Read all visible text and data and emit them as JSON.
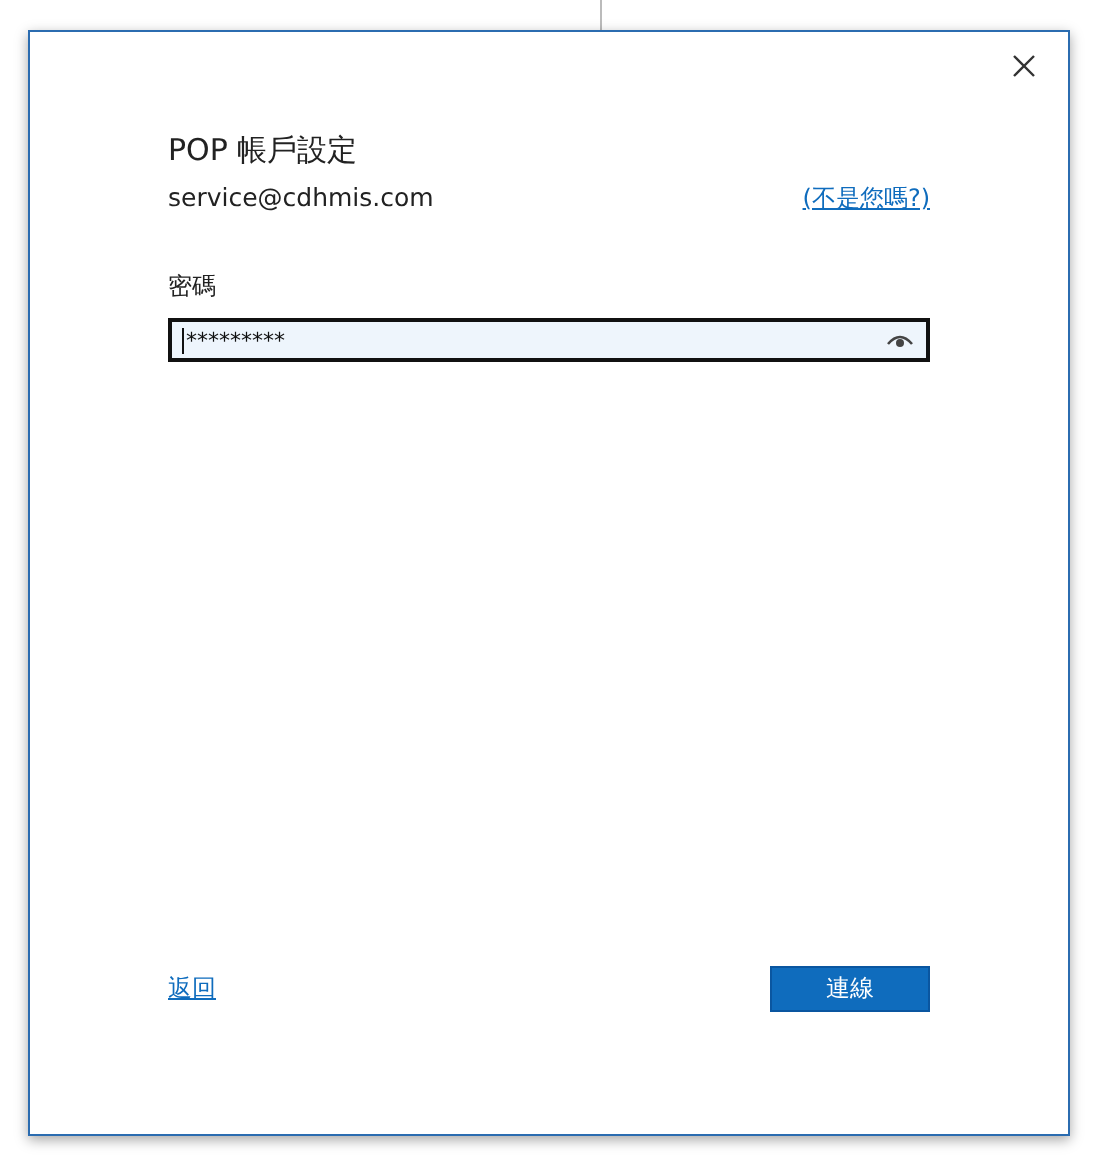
{
  "dialog": {
    "title": "POP 帳戶設定",
    "account": "service@cdhmis.com",
    "not_you_link": "(不是您嗎?)"
  },
  "password": {
    "label": "密碼",
    "value": "*********"
  },
  "footer": {
    "back_link": "返回",
    "connect_button": "連線"
  }
}
